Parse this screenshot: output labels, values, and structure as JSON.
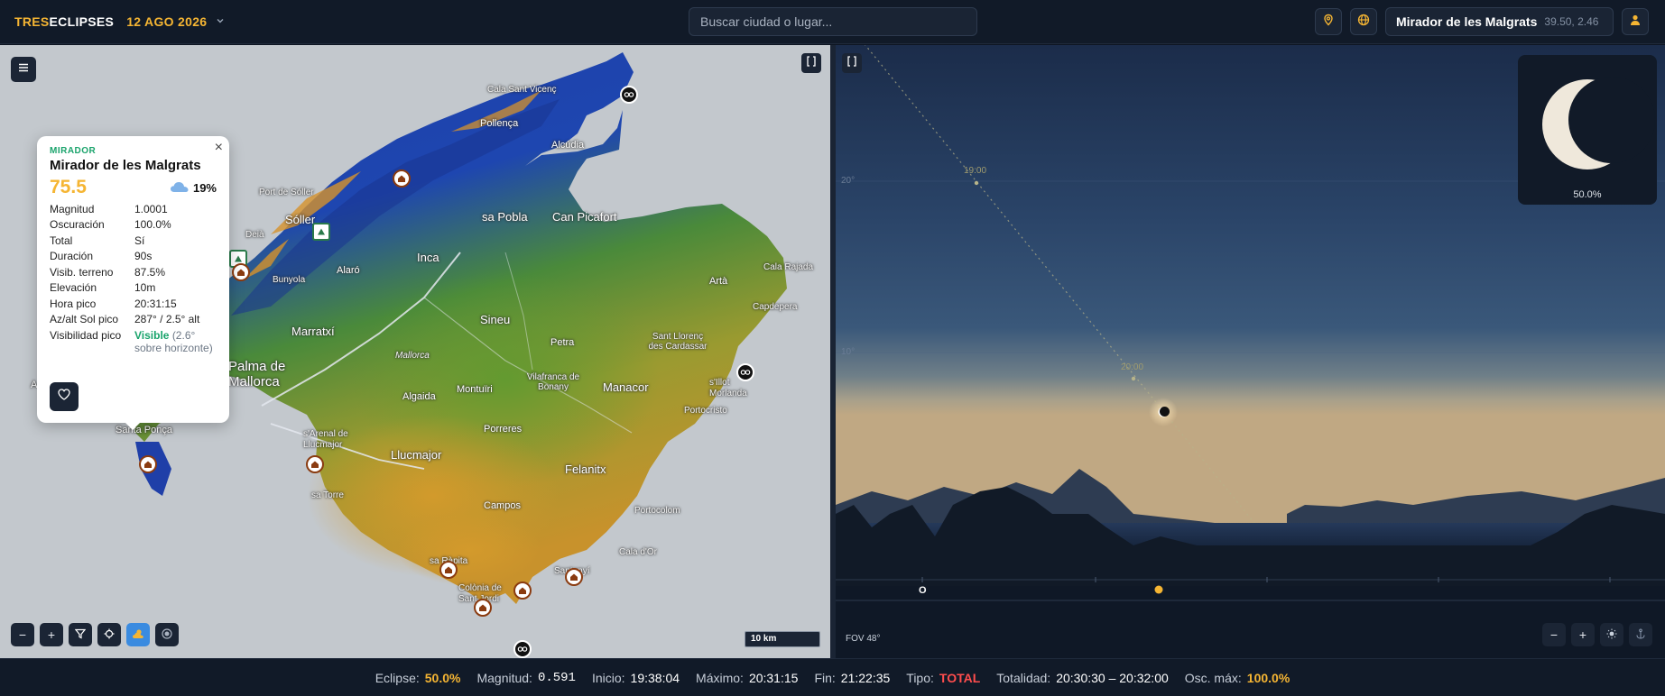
{
  "header": {
    "brand_part1": "TRES",
    "brand_part2": "ECLIPSES",
    "date": "12 AGO 2026",
    "search_placeholder": "Buscar ciudad o lugar...",
    "location_name": "Mirador de les Malgrats",
    "location_coords": "39.50, 2.46"
  },
  "map": {
    "labels": {
      "cala_sant_vicenc": "Cala Sant Vicenç",
      "pollenca": "Pollença",
      "alcudia": "Alcúdia",
      "port_soller": "Port de Sóller",
      "soller": "Sóller",
      "sa_pobla": "sa Pobla",
      "can_picafort": "Can Picafort",
      "deia": "Deià",
      "bunyola": "Bunyola",
      "alaro": "Alaró",
      "inca": "Inca",
      "cala_rajada": "Cala Rajada",
      "arta": "Artà",
      "capdepera": "Capdepera",
      "marratxi": "Marratxí",
      "sineu": "Sineu",
      "sant_llorenc": "Sant Llorenç des Cardassar",
      "petra": "Petra",
      "palma": "Palma de Mallorca",
      "s_illot": "s'Illot Morlanda",
      "vilafranca": "Vilafranca de Bonany",
      "manacor": "Manacor",
      "algaida": "Algaida",
      "montuiri": "Montuïri",
      "portocristo": "Portocristo",
      "santa_ponca": "Santa Ponça",
      "s_arenal": "s'Arenal de Llucmajor",
      "porreres": "Porreres",
      "llucmajor": "Llucmajor",
      "felanitx": "Felanitx",
      "sa_torre": "sa Torre",
      "campos": "Campos",
      "portocolom": "Portocolom",
      "cala_dor": "Cala d'Or",
      "sa_rapita": "sa Ràpita",
      "santanyi": "Santanyí",
      "colonia": "Colònia de Sant Jordi",
      "mallorca": "Mallorca",
      "a": "A"
    },
    "scale_label": "10 km"
  },
  "popup": {
    "type": "MIRADOR",
    "title": "Mirador de les Malgrats",
    "score": "75.5",
    "cloud_pct": "19%",
    "rows": [
      {
        "k": "Magnitud",
        "v": "1.0001"
      },
      {
        "k": "Oscuración",
        "v": "100.0%"
      },
      {
        "k": "Total",
        "v": "Sí"
      },
      {
        "k": "Duración",
        "v": "90s"
      },
      {
        "k": "Visib. terreno",
        "v": "87.5%"
      },
      {
        "k": "Elevación",
        "v": "10m"
      },
      {
        "k": "Hora pico",
        "v": "20:31:15"
      },
      {
        "k": "Az/alt Sol pico",
        "v": "287° / 2.5° alt"
      }
    ],
    "visibility_key": "Visibilidad pico",
    "visibility_value": "Visible",
    "visibility_note": "(2.6° sobre horizonte)"
  },
  "sky": {
    "alt_20": "20°",
    "alt_10": "10°",
    "time_1900": "19:00",
    "time_2000": "20:00",
    "inset_pct": "50.0%",
    "axis_o": "O",
    "fov": "FOV 48°"
  },
  "status": {
    "eclipse_k": "Eclipse:",
    "eclipse_v": "50.0%",
    "magnitud_k": "Magnitud:",
    "magnitud_v": "0.591",
    "inicio_k": "Inicio:",
    "inicio_v": "19:38:04",
    "maximo_k": "Máximo:",
    "maximo_v": "20:31:15",
    "fin_k": "Fin:",
    "fin_v": "21:22:35",
    "tipo_k": "Tipo:",
    "tipo_v": "TOTAL",
    "totalidad_k": "Totalidad:",
    "totalidad_v": "20:30:30 – 20:32:00",
    "osc_k": "Osc. máx:",
    "osc_v": "100.0%"
  },
  "colors": {
    "accent": "#f5b533",
    "total": "#ff4d4d",
    "visible": "#19a36b"
  }
}
